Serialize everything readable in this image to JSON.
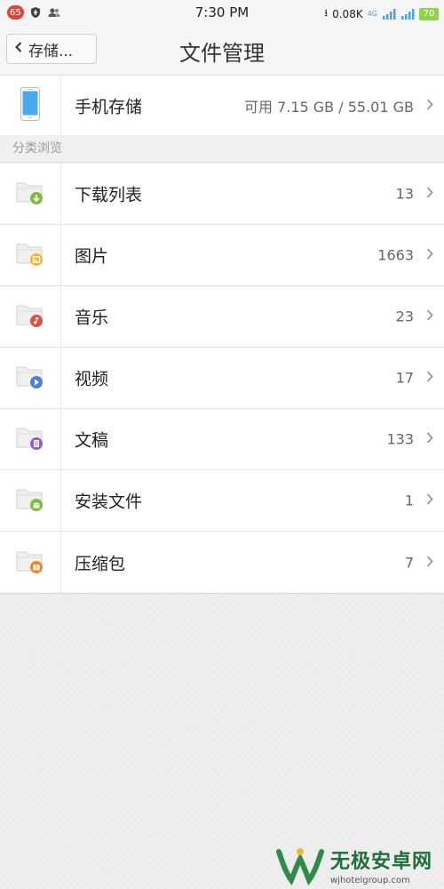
{
  "status_bar": {
    "notification_count": "65",
    "time": "7:30 PM",
    "network_speed": "0.08K",
    "network_type": "4G",
    "battery": "70"
  },
  "header": {
    "back_label": "存储...",
    "title": "文件管理"
  },
  "storage": {
    "label": "手机存储",
    "value": "可用 7.15 GB / 55.01 GB"
  },
  "section_title": "分类浏览",
  "categories": [
    {
      "label": "下载列表",
      "count": "13",
      "icon": "download-folder-icon",
      "color": "#7cbd3c"
    },
    {
      "label": "图片",
      "count": "1663",
      "icon": "image-folder-icon",
      "color": "#f2b632"
    },
    {
      "label": "音乐",
      "count": "23",
      "icon": "music-folder-icon",
      "color": "#e0503f"
    },
    {
      "label": "视频",
      "count": "17",
      "icon": "video-folder-icon",
      "color": "#4f7fd9"
    },
    {
      "label": "文稿",
      "count": "133",
      "icon": "document-folder-icon",
      "color": "#9a5bc3"
    },
    {
      "label": "安装文件",
      "count": "1",
      "icon": "android-folder-icon",
      "color": "#7cbd3c"
    },
    {
      "label": "压缩包",
      "count": "7",
      "icon": "archive-folder-icon",
      "color": "#ef8a2c"
    }
  ],
  "watermark": {
    "title": "无极安卓网",
    "url": "wjhotelgroup.com"
  },
  "colors": {
    "phone_icon": "#4aa8f0",
    "signal": "#4aa3e0",
    "battery": "#8fd34a"
  }
}
